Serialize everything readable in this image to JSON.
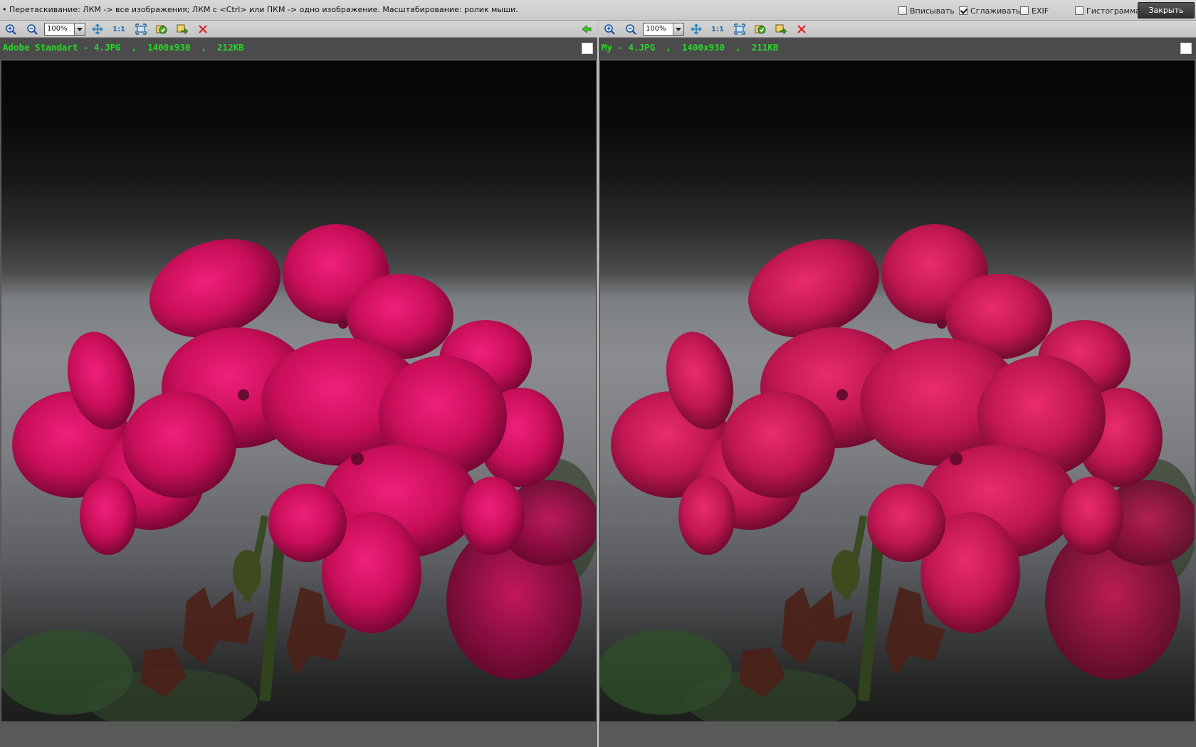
{
  "topbar": {
    "hint": "• Перетаскивание: ЛКМ -> все изображения; ЛКМ с <Ctrl> или ПКМ -> одно изображение. Масштабирование: ролик мыши.",
    "options": [
      {
        "label": "Вписывать",
        "checked": false
      },
      {
        "label": "Сглаживать",
        "checked": true
      },
      {
        "label": "EXIF",
        "checked": false
      },
      {
        "label": "Гистограмма",
        "checked": false
      }
    ],
    "close_label": "Закрыть"
  },
  "panes": [
    {
      "zoom": "100%",
      "one_to_one_label": "1:1",
      "info": "Adobe Standart - 4.JPG  ,  1400x930  ,  212KB",
      "toolbar_icons": [
        "zoom-in-icon",
        "zoom-out-icon",
        "fit-icon",
        "actual-size-icon",
        "fullscreen-icon",
        "copy-image-icon",
        "save-image-icon",
        "close-x-icon",
        "sync-arrow-icon"
      ]
    },
    {
      "zoom": "100%",
      "one_to_one_label": "1:1",
      "info": "My - 4.JPG  ,  1400x930  ,  211KB",
      "toolbar_icons": [
        "zoom-in-icon",
        "zoom-out-icon",
        "fit-icon",
        "actual-size-icon",
        "fullscreen-icon",
        "copy-image-icon",
        "save-image-icon",
        "close-x-icon"
      ]
    }
  ],
  "colors": {
    "info_text": "#2ad62a",
    "flower": "#d0115e",
    "toolbar_bg": "#cdcdcd"
  }
}
